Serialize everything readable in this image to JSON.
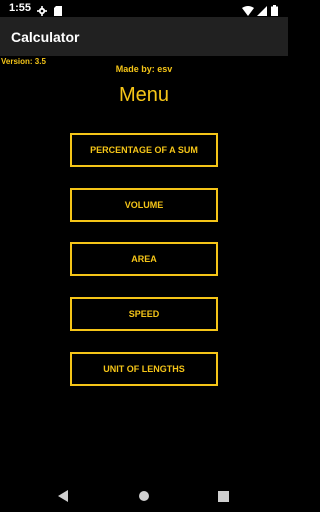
{
  "status_bar": {
    "time": "1:55",
    "icons": [
      "gear-icon",
      "sd-card-icon",
      "wifi-icon",
      "signal-icon",
      "battery-icon"
    ]
  },
  "app_bar": {
    "title": "Calculator"
  },
  "main": {
    "version": "Version: 3.5",
    "made_by": "Made by: esv",
    "menu_title": "Menu",
    "buttons": [
      {
        "label": "PERCENTAGE OF A SUM"
      },
      {
        "label": "VOLUME"
      },
      {
        "label": "AREA"
      },
      {
        "label": "SPEED"
      },
      {
        "label": "UNIT OF LENGTHS"
      }
    ]
  },
  "nav_bar": {
    "icons": [
      "back-icon",
      "home-icon",
      "recents-icon"
    ]
  },
  "colors": {
    "accent": "#f5c518",
    "background": "#000000",
    "app_bar": "#212121"
  }
}
